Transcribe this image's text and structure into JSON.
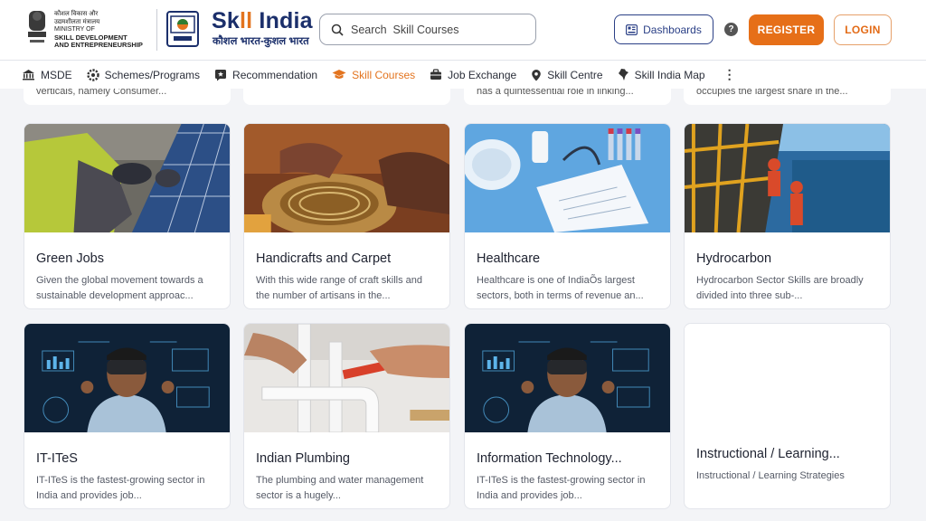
{
  "header": {
    "ministry_lines": [
      "कौशल विकास और",
      "उद्यमशीलता मंत्रालय",
      "MINISTRY OF",
      "SKILL DEVELOPMENT",
      "AND ENTREPRENEURSHIP"
    ],
    "brand_title_a": "Sk",
    "brand_title_b": "ll",
    "brand_title_c": " India",
    "brand_subtitle": "कौशल भारत-कुशल भारत",
    "search_placeholder": "Search  Skill Courses",
    "dashboards_label": "Dashboards",
    "help_label": "?",
    "register_label": "REGISTER",
    "login_label": "LOGIN"
  },
  "nav": {
    "items": [
      {
        "label": "MSDE",
        "icon": "building-icon",
        "active": false
      },
      {
        "label": "Schemes/Programs",
        "icon": "gear-icon",
        "active": false
      },
      {
        "label": "Recommendation",
        "icon": "recommendation-icon",
        "active": false
      },
      {
        "label": "Skill Courses",
        "icon": "graduation-cap-icon",
        "active": true
      },
      {
        "label": "Job Exchange",
        "icon": "briefcase-icon",
        "active": false
      },
      {
        "label": "Skill Centre",
        "icon": "location-pin-icon",
        "active": false
      },
      {
        "label": "Skill India Map",
        "icon": "india-map-icon",
        "active": false
      }
    ],
    "more_icon": "more-vertical-icon"
  },
  "peek_cards": [
    {
      "desc": "verticals, namely Consumer..."
    },
    {
      "desc": ""
    },
    {
      "desc": "has a quintessential role in linking..."
    },
    {
      "desc": "occupies the largest share in the..."
    }
  ],
  "cards": [
    {
      "title": "Green Jobs",
      "desc": "Given the global movement towards a sustainable development approac...",
      "image": "solar-panel-worker-photo"
    },
    {
      "title": "Handicrafts and Carpet",
      "desc": "With this wide range of craft skills and the number of artisans in the...",
      "image": "basket-weaving-photo"
    },
    {
      "title": "Healthcare",
      "desc": "Healthcare is one of IndiaÕs largest sectors, both in terms of revenue an...",
      "image": "medical-lab-photo"
    },
    {
      "title": "Hydrocarbon",
      "desc": "Hydrocarbon Sector Skills are broadly divided into three sub-...",
      "image": "offshore-rig-photo"
    },
    {
      "title": "IT-ITeS",
      "desc": "IT-ITeS is the fastest-growing sector in India and provides job...",
      "image": "vr-headset-photo"
    },
    {
      "title": "Indian Plumbing",
      "desc": "The plumbing and water management sector is a hugely...",
      "image": "plumbing-pipes-photo"
    },
    {
      "title": "Information Technology...",
      "desc": "IT-ITeS is the fastest-growing sector in India and provides job...",
      "image": "vr-headset-photo"
    },
    {
      "title": "Instructional / Learning...",
      "desc": "Instructional / Learning Strategies",
      "image": "none"
    }
  ]
}
